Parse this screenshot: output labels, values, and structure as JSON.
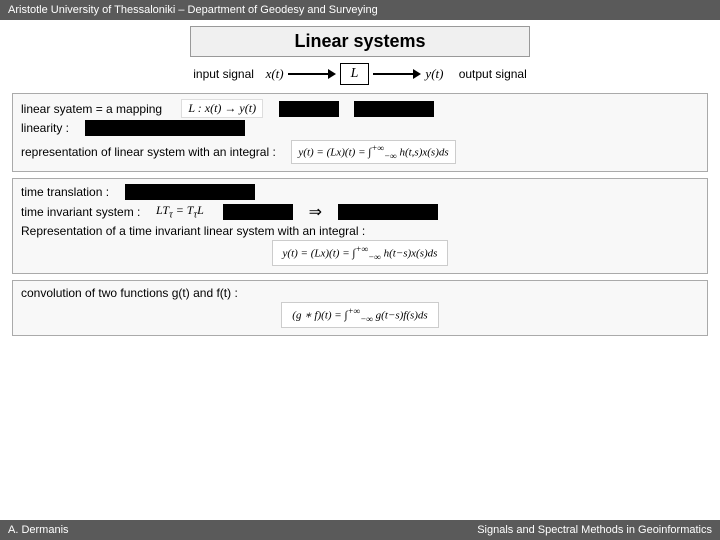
{
  "header": {
    "label": "Aristotle University of Thessaloniki – Department of Geodesy and Surveying"
  },
  "title": "Linear systems",
  "signal": {
    "input_label": "input signal",
    "output_label": "output signal",
    "block_label": "L"
  },
  "section1": {
    "linear_system_label": "linear syatem = a mapping",
    "linearity_label": "linearity :",
    "representation_label": "representation of linear system with an integral :"
  },
  "section2": {
    "time_translation_label": "time translation :",
    "time_invariant_label": "time invariant system :",
    "representation_integral_label": "Representation of a time invariant linear system with an integral :"
  },
  "section3": {
    "convolution_label": "convolution of two functions  g(t)  and  f(t) :"
  },
  "footer": {
    "left": "A. Dermanis",
    "right": "Signals and Spectral Methods in Geoinformatics"
  }
}
